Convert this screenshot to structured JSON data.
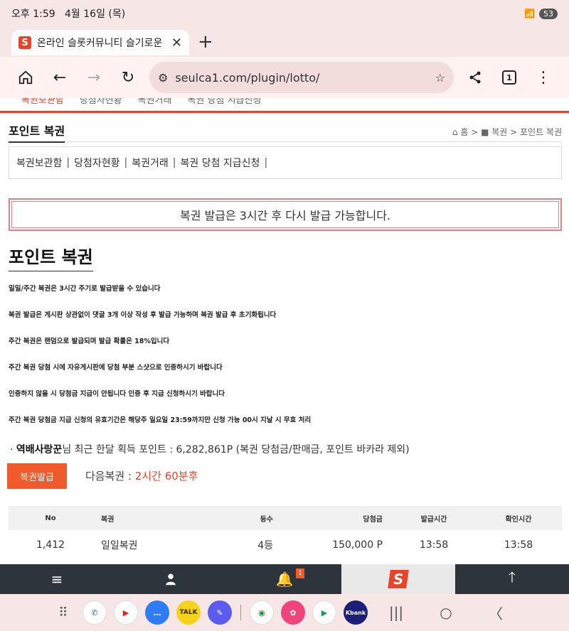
{
  "status": {
    "time": "오후 1:59",
    "date": "4월 16일 (목)",
    "battery": "53"
  },
  "browser": {
    "tab_title": "온라인 슬롯커뮤니티 슬기로운",
    "favicon_letter": "S",
    "url": "seulca1.com/plugin/lotto/",
    "tab_count": "1"
  },
  "nav_cut": [
    "복권보관함",
    "당첨자현황",
    "복권거래",
    "복권 당첨 지급신청"
  ],
  "breadcrumb": {
    "title": "포인트 복권",
    "path": "홈 > ■ 복권 > 포인트 복권"
  },
  "submenu": {
    "items": [
      "복권보관함",
      "당첨자현황",
      "복권거래",
      "복권 당첨 지급신청"
    ],
    "separator": "|"
  },
  "alert": "복권 발급은 3시간 후 다시 발급 가능합니다.",
  "heading": "포인트 복권",
  "notes": [
    "일일/주간 복권은 3시간 주기로 발급받을 수 있습니다",
    "복권 발급은 게시판 상관없이 댓글 3개 이상 작성 후 발급 가능하며 복권 발급 후 초기화됩니다",
    "주간 복권은 랜덤으로 발급되며 발급 확률은 18%입니다",
    "주간 복권 당첨 시에 자유게시판에 당첨 부분 스샷으로 인증하시기 바랍니다",
    "인증하지 않을 시 당첨금 지급이 안됩니다 인증 후 지급 신청하시기 바랍니다",
    "주간 복권 당첨금 지급 신청의 유효기간은 해당주 일요일 23:59까지만 신청 가능 00시 지날 시 무효 처리"
  ],
  "points": {
    "bullet": "·",
    "user": "역배사랑꾼",
    "text": "님 최근 한달 획득 포인트 : 6,282,861P (복권 당첨금/판매금, 포인트 바카라 제외)"
  },
  "issue_button": "복권발급",
  "next": {
    "label": "다음복권 : ",
    "value": "2시간 60분후"
  },
  "table": {
    "headers": [
      "No",
      "복권",
      "등수",
      "당첨금",
      "발급시간",
      "확인시간"
    ],
    "rows": [
      [
        "1,412",
        "일일복권",
        "4등",
        "150,000 P",
        "13:58",
        "13:58"
      ]
    ]
  },
  "sitebar": {
    "notify_count": "1",
    "logo_letter": "S"
  },
  "dock": {
    "apps": [
      {
        "name": "phone-app",
        "label": "✆",
        "color": "#ffffff",
        "fg": "#2a5bd7"
      },
      {
        "name": "youtube-app",
        "label": "▶",
        "color": "#ffffff",
        "fg": "#e62117"
      },
      {
        "name": "messages-app",
        "label": "…",
        "color": "#2f7df6",
        "fg": "#ffffff"
      },
      {
        "name": "kakaotalk-app",
        "label": "TALK",
        "color": "#f6d21a",
        "fg": "#3b2a1a"
      },
      {
        "name": "notes-app",
        "label": "✎",
        "color": "#5b5bf0",
        "fg": "#ffffff"
      },
      {
        "name": "chrome-app",
        "label": "◉",
        "color": "#ffffff",
        "fg": "#1e8e3e"
      },
      {
        "name": "gallery-app",
        "label": "✿",
        "color": "#f0457a",
        "fg": "#ffffff"
      },
      {
        "name": "play-store-app",
        "label": "▶",
        "color": "#ffffff",
        "fg": "#0f9d58"
      },
      {
        "name": "kbank-app",
        "label": "Kbank",
        "color": "#1c1f7a",
        "fg": "#ffffff"
      }
    ]
  }
}
